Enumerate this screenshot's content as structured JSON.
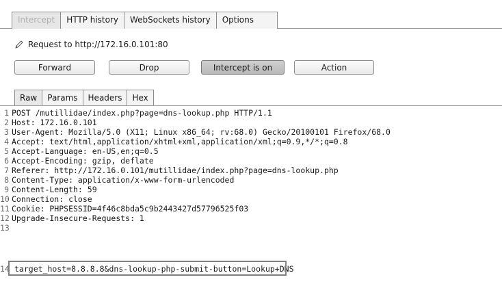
{
  "tabs": [
    "Intercept",
    "HTTP history",
    "WebSockets history",
    "Options"
  ],
  "request": {
    "label": "Request to http://172.16.0.101:80"
  },
  "buttons": {
    "forward": "Forward",
    "drop": "Drop",
    "intercept": "Intercept is on",
    "action": "Action"
  },
  "subtabs": [
    "Raw",
    "Params",
    "Headers",
    "Hex"
  ],
  "lines": [
    "POST /mutillidae/index.php?page=dns-lookup.php HTTP/1.1",
    "Host: 172.16.0.101",
    "User-Agent: Mozilla/5.0 (X11; Linux x86_64; rv:68.0) Gecko/20100101 Firefox/68.0",
    "Accept: text/html,application/xhtml+xml,application/xml;q=0.9,*/*;q=0.8",
    "Accept-Language: en-US,en;q=0.5",
    "Accept-Encoding: gzip, deflate",
    "Referer: http://172.16.0.101/mutillidae/index.php?page=dns-lookup.php",
    "Content-Type: application/x-www-form-urlencoded",
    "Content-Length: 59",
    "Connection: close",
    "Cookie: PHPSESSID=4f46c8bda5c9b2443427d57796525f03",
    "Upgrade-Insecure-Requests: 1",
    "",
    "target_host=8.8.8.8&dns-lookup-php-submit-button=Lookup+DNS"
  ],
  "line_numbers": [
    "1",
    "2",
    "3",
    "4",
    "5",
    "6",
    "7",
    "8",
    "9",
    "10",
    "11",
    "12",
    "13",
    "14"
  ]
}
